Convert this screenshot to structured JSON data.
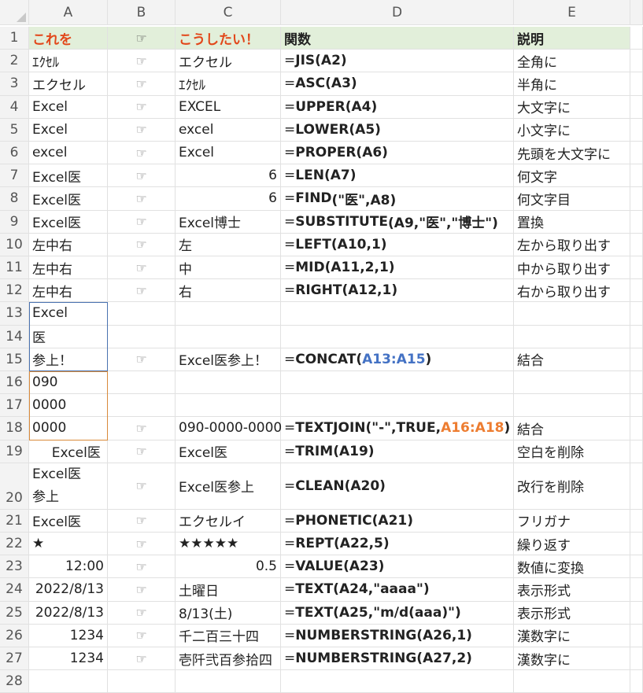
{
  "columns": [
    "A",
    "B",
    "C",
    "D",
    "E"
  ],
  "header_row": {
    "num": "1",
    "a": "これを",
    "b_icon": "pointing-hand-icon",
    "c": "こうしたい！",
    "d": "関数",
    "e": "説明"
  },
  "hand_glyph": "☞",
  "rows": [
    {
      "num": "2",
      "a": "ｴｸｾﾙ",
      "c": "エクセル",
      "d_pre": "=",
      "d_fn": "JIS",
      "d_args": "(A2)",
      "e": "全角に"
    },
    {
      "num": "3",
      "a": "エクセル",
      "c": "ｴｸｾﾙ",
      "d_pre": "=",
      "d_fn": "ASC",
      "d_args": "(A3)",
      "e": "半角に"
    },
    {
      "num": "4",
      "a": "Excel",
      "c": "EXCEL",
      "d_pre": "=",
      "d_fn": "UPPER",
      "d_args": "(A4)",
      "e": "大文字に"
    },
    {
      "num": "5",
      "a": "Excel",
      "c": "excel",
      "d_pre": "=",
      "d_fn": "LOWER",
      "d_args": "(A5)",
      "e": "小文字に"
    },
    {
      "num": "6",
      "a": "excel",
      "c": "Excel",
      "d_pre": "=",
      "d_fn": "PROPER",
      "d_args": "(A6)",
      "e": "先頭を大文字に"
    },
    {
      "num": "7",
      "a": "Excel医",
      "c": "6",
      "d_pre": "=",
      "d_fn": "LEN",
      "d_args": "(A7)",
      "e": "何文字"
    },
    {
      "num": "8",
      "a": "Excel医",
      "c": "6",
      "d_pre": "=",
      "d_fn": "FIND",
      "d_args": "(\"医\",A8)",
      "e": "何文字目"
    },
    {
      "num": "9",
      "a": "Excel医",
      "c": "Excel博士",
      "d_pre": "=",
      "d_fn": "SUBSTITUTE",
      "d_args": "(A9,\"医\",\"博士\")",
      "e": "置換"
    },
    {
      "num": "10",
      "a": "左中右",
      "c": "左",
      "d_pre": "=",
      "d_fn": "LEFT",
      "d_args": "(A10,1)",
      "e": "左から取り出す"
    },
    {
      "num": "11",
      "a": "左中右",
      "c": "中",
      "d_pre": "=",
      "d_fn": "MID",
      "d_args": "(A11,2,1)",
      "e": "中から取り出す"
    },
    {
      "num": "12",
      "a": "左中右",
      "c": "右",
      "d_pre": "=",
      "d_fn": "RIGHT",
      "d_args": "(A12,1)",
      "e": "右から取り出す"
    },
    {
      "num": "13",
      "a": "Excel",
      "c": "",
      "d_pre": "",
      "d_fn": "",
      "d_args": "",
      "e": ""
    },
    {
      "num": "14",
      "a": "医",
      "c": "",
      "d_pre": "",
      "d_fn": "",
      "d_args": "",
      "e": ""
    },
    {
      "num": "15",
      "a": "参上！",
      "c": "Excel医参上！",
      "d_pre": "=",
      "d_fn": "CONCAT",
      "d_args_open": "(",
      "d_args_ref": "A13:A15",
      "d_args_close": ")",
      "e": "結合"
    },
    {
      "num": "16",
      "a": "090",
      "c": "",
      "d_pre": "",
      "d_fn": "",
      "d_args": "",
      "e": ""
    },
    {
      "num": "17",
      "a": "0000",
      "c": "",
      "d_pre": "",
      "d_fn": "",
      "d_args": "",
      "e": ""
    },
    {
      "num": "18",
      "a": "0000",
      "c": "090-0000-0000",
      "d_pre": "=",
      "d_fn": "TEXTJOIN",
      "d_args_open": "(\"-\",TRUE,",
      "d_args_ref": "A16:A18",
      "d_args_close": ")",
      "e": "結合"
    },
    {
      "num": "19",
      "a": "  Excel医",
      "c": "Excel医",
      "d_pre": "=",
      "d_fn": "TRIM",
      "d_args": "(A19)",
      "e": "空白を削除"
    },
    {
      "num": "20",
      "a_line1": "Excel医",
      "a_line2": "参上",
      "c": "Excel医参上",
      "d_pre": "=",
      "d_fn": "CLEAN",
      "d_args": "(A20)",
      "e": "改行を削除"
    },
    {
      "num": "21",
      "a": "Excel医",
      "c": "エクセルイ",
      "d_pre": "=",
      "d_fn": "PHONETIC",
      "d_args": "(A21)",
      "e": "フリガナ"
    },
    {
      "num": "22",
      "a": "★",
      "c": "★★★★★",
      "d_pre": "=",
      "d_fn": "REPT",
      "d_args": "(A22,5)",
      "e": "繰り返す"
    },
    {
      "num": "23",
      "a": "12:00",
      "c": "0.5",
      "d_pre": "=",
      "d_fn": "VALUE",
      "d_args": "(A23)",
      "e": "数値に変換"
    },
    {
      "num": "24",
      "a": "2022/8/13",
      "c": "土曜日",
      "d_pre": "=",
      "d_fn": "TEXT",
      "d_args": "(A24,\"aaaa\")",
      "e": "表示形式"
    },
    {
      "num": "25",
      "a": "2022/8/13",
      "c": "8/13(土)",
      "d_pre": "=",
      "d_fn": "TEXT",
      "d_args": "(A25,\"m/d(aaa)\")",
      "e": "表示形式"
    },
    {
      "num": "26",
      "a": "1234",
      "c": "千二百三十四",
      "d_pre": "=",
      "d_fn": "NUMBERSTRING",
      "d_args": "(A26,1)",
      "e": "漢数字に"
    },
    {
      "num": "27",
      "a": "1234",
      "c": "壱阡弐百参拾四",
      "d_pre": "=",
      "d_fn": "NUMBERSTRING",
      "d_args": "(A27,2)",
      "e": "漢数字に"
    },
    {
      "num": "28"
    }
  ],
  "colors": {
    "header_fill": "#e2efda",
    "header_red": "#e2471a",
    "range_blue": "#4472c4",
    "range_orange": "#ed7d31",
    "gridline": "#e1e1e1"
  }
}
